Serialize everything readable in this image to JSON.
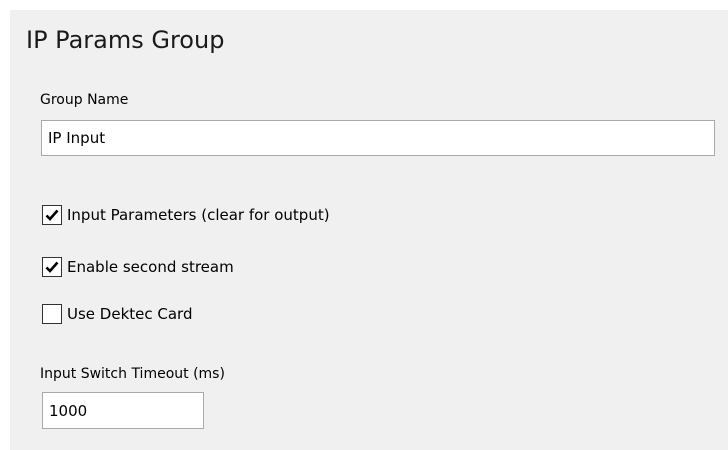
{
  "panel": {
    "title": "IP Params Group"
  },
  "group_name": {
    "label": "Group Name",
    "value": "IP Input"
  },
  "checkboxes": [
    {
      "label": "Input Parameters (clear for output)",
      "checked": true
    },
    {
      "label": "Enable second stream",
      "checked": true
    },
    {
      "label": "Use Dektec Card",
      "checked": false
    }
  ],
  "switch_timeout": {
    "label": "Input Switch Timeout (ms)",
    "value": "1000"
  },
  "colors": {
    "panel_background": "#f0f0f0",
    "input_border": "#a9a9a9"
  }
}
